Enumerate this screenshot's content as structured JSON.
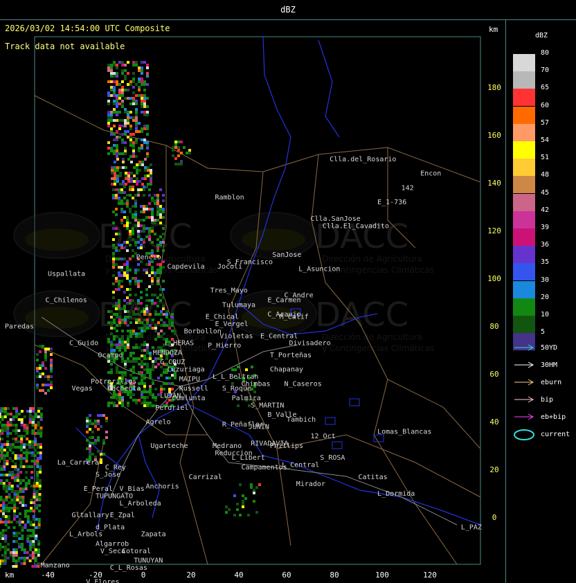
{
  "window_title": "dBZ",
  "header": {
    "timestamp": "2026/03/02 14:54:00 UTC Composite",
    "track_warning": "Track data not available",
    "km_label": "km"
  },
  "axes": {
    "x_ticks": [
      "-40",
      "-20",
      "0",
      "20",
      "40",
      "60",
      "80",
      "100",
      "120"
    ],
    "y_ticks": [
      "180",
      "160",
      "140",
      "120",
      "100",
      "80",
      "60",
      "40",
      "20",
      "0"
    ],
    "x_unit": "km",
    "y_unit": "km"
  },
  "legend": {
    "title": "dBZ",
    "levels": [
      {
        "label": "80",
        "color": "#d8d8d8"
      },
      {
        "label": "70",
        "color": "#b8b8b8"
      },
      {
        "label": "65",
        "color": "#ff3333"
      },
      {
        "label": "60",
        "color": "#ff6a00"
      },
      {
        "label": "57",
        "color": "#ff9966"
      },
      {
        "label": "54",
        "color": "#ffff00"
      },
      {
        "label": "51",
        "color": "#ffcc33"
      },
      {
        "label": "48",
        "color": "#cc8844"
      },
      {
        "label": "45",
        "color": "#cc6688"
      },
      {
        "label": "42",
        "color": "#cc3399"
      },
      {
        "label": "39",
        "color": "#cc1177"
      },
      {
        "label": "36",
        "color": "#6633cc"
      },
      {
        "label": "35",
        "color": "#3355ee"
      },
      {
        "label": "30",
        "color": "#1a88dd"
      },
      {
        "label": "20",
        "color": "#118811"
      },
      {
        "label": "10",
        "color": "#115511"
      },
      {
        "label": "5",
        "color": "#443388"
      }
    ],
    "tracks": [
      {
        "label": "50YD",
        "color": "#33dddd"
      },
      {
        "label": "30HM",
        "color": "#ffffff"
      },
      {
        "label": "eburn",
        "color": "#ffcc88"
      },
      {
        "label": "bip",
        "color": "#ffcccc"
      },
      {
        "label": "eb+bip",
        "color": "#ff44ff"
      },
      {
        "label": "current",
        "color": "#33dddd"
      }
    ]
  },
  "watermark": {
    "brand": "DACC",
    "line1": "Dirección de Agricultura",
    "line2": "y Contingencias Climáticas"
  },
  "places": [
    {
      "name": "Clla.del_Rosario",
      "x": 78,
      "y": 149
    },
    {
      "name": "Encon",
      "x": 116,
      "y": 143
    },
    {
      "name": "142",
      "x": 108,
      "y": 137
    },
    {
      "name": "E_1-736",
      "x": 98,
      "y": 131
    },
    {
      "name": "Ramblon",
      "x": 30,
      "y": 133
    },
    {
      "name": "Clla.SanJose",
      "x": 70,
      "y": 124
    },
    {
      "name": "Clla.El_Cavadito",
      "x": 75,
      "y": 121
    },
    {
      "name": "S_Francisco",
      "x": 35,
      "y": 106
    },
    {
      "name": "SanJose",
      "x": 54,
      "y": 109
    },
    {
      "name": "L_Asuncion",
      "x": 65,
      "y": 103
    },
    {
      "name": "Pencio",
      "x": -3,
      "y": 108
    },
    {
      "name": "Capdevila",
      "x": 10,
      "y": 104
    },
    {
      "name": "Jocoli",
      "x": 31,
      "y": 104
    },
    {
      "name": "Uspallata",
      "x": -40,
      "y": 101
    },
    {
      "name": "Tres_Mayo",
      "x": 28,
      "y": 94
    },
    {
      "name": "C_Andre",
      "x": 59,
      "y": 92
    },
    {
      "name": "E_Carmen",
      "x": 52,
      "y": 90
    },
    {
      "name": "C_Chilenos",
      "x": -41,
      "y": 90
    },
    {
      "name": "Tulumaya",
      "x": 33,
      "y": 88
    },
    {
      "name": "C_Araujo",
      "x": 52,
      "y": 84
    },
    {
      "name": "M_Calif",
      "x": 57,
      "y": 83
    },
    {
      "name": "E_Chical",
      "x": 26,
      "y": 83
    },
    {
      "name": "E_Vergel",
      "x": 30,
      "y": 80
    },
    {
      "name": "Paredas",
      "x": -58,
      "y": 79
    },
    {
      "name": "Borbollon",
      "x": 17,
      "y": 77
    },
    {
      "name": "Violetas",
      "x": 32,
      "y": 75
    },
    {
      "name": "E_Central",
      "x": 49,
      "y": 75
    },
    {
      "name": "Divisadero",
      "x": 61,
      "y": 72
    },
    {
      "name": "C_Guido",
      "x": -31,
      "y": 72
    },
    {
      "name": "L_HERAS",
      "x": 9,
      "y": 72
    },
    {
      "name": "P_Hierro",
      "x": 27,
      "y": 71
    },
    {
      "name": "Ocampo",
      "x": -19,
      "y": 67
    },
    {
      "name": "MENDOZA",
      "x": 4,
      "y": 68
    },
    {
      "name": "T_Porteñas",
      "x": 53,
      "y": 67
    },
    {
      "name": "G_CRUZ",
      "x": 7,
      "y": 64
    },
    {
      "name": "Luzuriaga",
      "x": 10,
      "y": 61
    },
    {
      "name": "Chapanay",
      "x": 53,
      "y": 61
    },
    {
      "name": "L_L_Beltran",
      "x": 29,
      "y": 58
    },
    {
      "name": "Chimbas",
      "x": 41,
      "y": 55
    },
    {
      "name": "N_Caseros",
      "x": 59,
      "y": 55
    },
    {
      "name": "Potrerillos",
      "x": -22,
      "y": 56
    },
    {
      "name": "MAIPU",
      "x": 15,
      "y": 57
    },
    {
      "name": "S_Roque",
      "x": 33,
      "y": 53
    },
    {
      "name": "Vegas",
      "x": -30,
      "y": 53
    },
    {
      "name": "Cacheuta",
      "x": -15,
      "y": 53
    },
    {
      "name": "Russell",
      "x": 15,
      "y": 53
    },
    {
      "name": "Palmira",
      "x": 37,
      "y": 49
    },
    {
      "name": "LUJAN",
      "x": 7,
      "y": 50
    },
    {
      "name": "Cumlunta",
      "x": 12,
      "y": 49
    },
    {
      "name": "S_MARTIN",
      "x": 45,
      "y": 46
    },
    {
      "name": "Perdriel",
      "x": 5,
      "y": 45
    },
    {
      "name": "B_Valle",
      "x": 52,
      "y": 42
    },
    {
      "name": "Tambich",
      "x": 60,
      "y": 40
    },
    {
      "name": "Agrelo",
      "x": 1,
      "y": 39
    },
    {
      "name": "R_Peñaflor",
      "x": 33,
      "y": 38
    },
    {
      "name": "JUNIN",
      "x": 44,
      "y": 37
    },
    {
      "name": "Lomas_Blancas",
      "x": 98,
      "y": 35
    },
    {
      "name": "Medrano",
      "x": 29,
      "y": 29
    },
    {
      "name": "RIVADAVIA",
      "x": 45,
      "y": 30
    },
    {
      "name": "12_Oct",
      "x": 70,
      "y": 33
    },
    {
      "name": "Phillips",
      "x": 53,
      "y": 29
    },
    {
      "name": "Ugarteche",
      "x": 3,
      "y": 29
    },
    {
      "name": "Reduccion",
      "x": 30,
      "y": 26
    },
    {
      "name": "L_Libert",
      "x": 37,
      "y": 24
    },
    {
      "name": "S_ROSA",
      "x": 74,
      "y": 24
    },
    {
      "name": "Campamentos",
      "x": 41,
      "y": 20
    },
    {
      "name": "L_Central",
      "x": 58,
      "y": 21
    },
    {
      "name": "La_Carrera",
      "x": -36,
      "y": 22
    },
    {
      "name": "C_Rey",
      "x": -16,
      "y": 20
    },
    {
      "name": "Carrizal",
      "x": 19,
      "y": 16
    },
    {
      "name": "Catitas",
      "x": 90,
      "y": 16
    },
    {
      "name": "S_Jose",
      "x": -20,
      "y": 17
    },
    {
      "name": "Mirador",
      "x": 64,
      "y": 13
    },
    {
      "name": "Anchoris",
      "x": 1,
      "y": 12
    },
    {
      "name": "E_Peral",
      "x": -25,
      "y": 11
    },
    {
      "name": "V_Bias",
      "x": -10,
      "y": 11
    },
    {
      "name": "TUPUNGATO",
      "x": -20,
      "y": 8
    },
    {
      "name": "L_Dormida",
      "x": 98,
      "y": 9
    },
    {
      "name": "L_Arboleda",
      "x": -10,
      "y": 5
    },
    {
      "name": "Gltallary",
      "x": -30,
      "y": 0
    },
    {
      "name": "E_Zpal",
      "x": -14,
      "y": 0
    },
    {
      "name": "d_Plata",
      "x": -20,
      "y": -5
    },
    {
      "name": "L_PAZ",
      "x": 133,
      "y": -5
    },
    {
      "name": "L_Arbols",
      "x": -31,
      "y": -8
    },
    {
      "name": "Zapata",
      "x": -1,
      "y": -8
    },
    {
      "name": "Algarrob",
      "x": -20,
      "y": -12
    },
    {
      "name": "V_Seca",
      "x": -18,
      "y": -15
    },
    {
      "name": "Cotoral",
      "x": -9,
      "y": -15
    },
    {
      "name": "TUNUYAN",
      "x": -4,
      "y": -19
    },
    {
      "name": "Manzano",
      "x": -43,
      "y": -21
    },
    {
      "name": "C_L_Rosas",
      "x": -14,
      "y": -22
    },
    {
      "name": "V_Flores",
      "x": -24,
      "y": -28
    }
  ]
}
